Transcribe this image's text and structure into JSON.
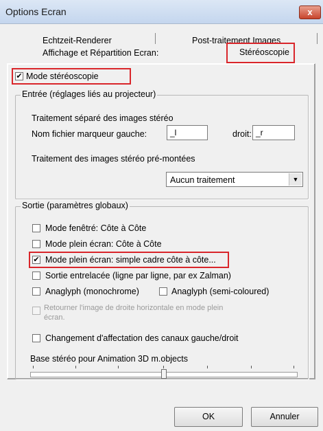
{
  "window": {
    "title": "Options Ecran",
    "close_label": "x"
  },
  "tabs": {
    "row1": [
      "Echtzeit-Renderer",
      "Post-traitement Images"
    ],
    "row2": [
      "Affichage et Répartition Ecran:",
      "Stéréoscopie"
    ],
    "active": "Stéréoscopie"
  },
  "stereo_mode": {
    "label": "Mode stéréoscopie",
    "checked": "✔"
  },
  "input_group": {
    "legend": "Entrée (réglages liés au projecteur)",
    "separate_label": "Traitement séparé des images stéréo",
    "left_marker_label": "Nom fichier marqueur gauche:",
    "left_marker_value": "_l",
    "right_label": "droit:",
    "right_value": "_r",
    "premounted_label": "Traitement des images stéréo pré-montées",
    "premounted_select": "Aucun traitement",
    "select_arrow": "▼"
  },
  "output_group": {
    "legend": "Sortie (paramètres globaux)",
    "options": [
      {
        "label": "Mode fenêtré: Côte à Côte",
        "mark": ""
      },
      {
        "label": "Mode plein écran: Côte à Côte",
        "mark": ""
      },
      {
        "label": "Mode plein écran: simple cadre côte à côte...",
        "mark": "✔"
      },
      {
        "label": "Sortie entrelacée (ligne par ligne, par ex Zalman)",
        "mark": ""
      },
      {
        "label": "Anaglyph (monochrome)",
        "mark": ""
      },
      {
        "label": "Anaglyph (semi-coloured)",
        "mark": ""
      }
    ],
    "flip_line1": "Retourner l'image de droite horizontale en mode plein",
    "flip_line2": "écran.",
    "channel_swap": "Changement d'affectation des canaux gauche/droit",
    "base_label": "Base stéréo pour Animation 3D m.objects",
    "slider_value": 0.5
  },
  "buttons": {
    "ok": "OK",
    "cancel": "Annuler"
  }
}
